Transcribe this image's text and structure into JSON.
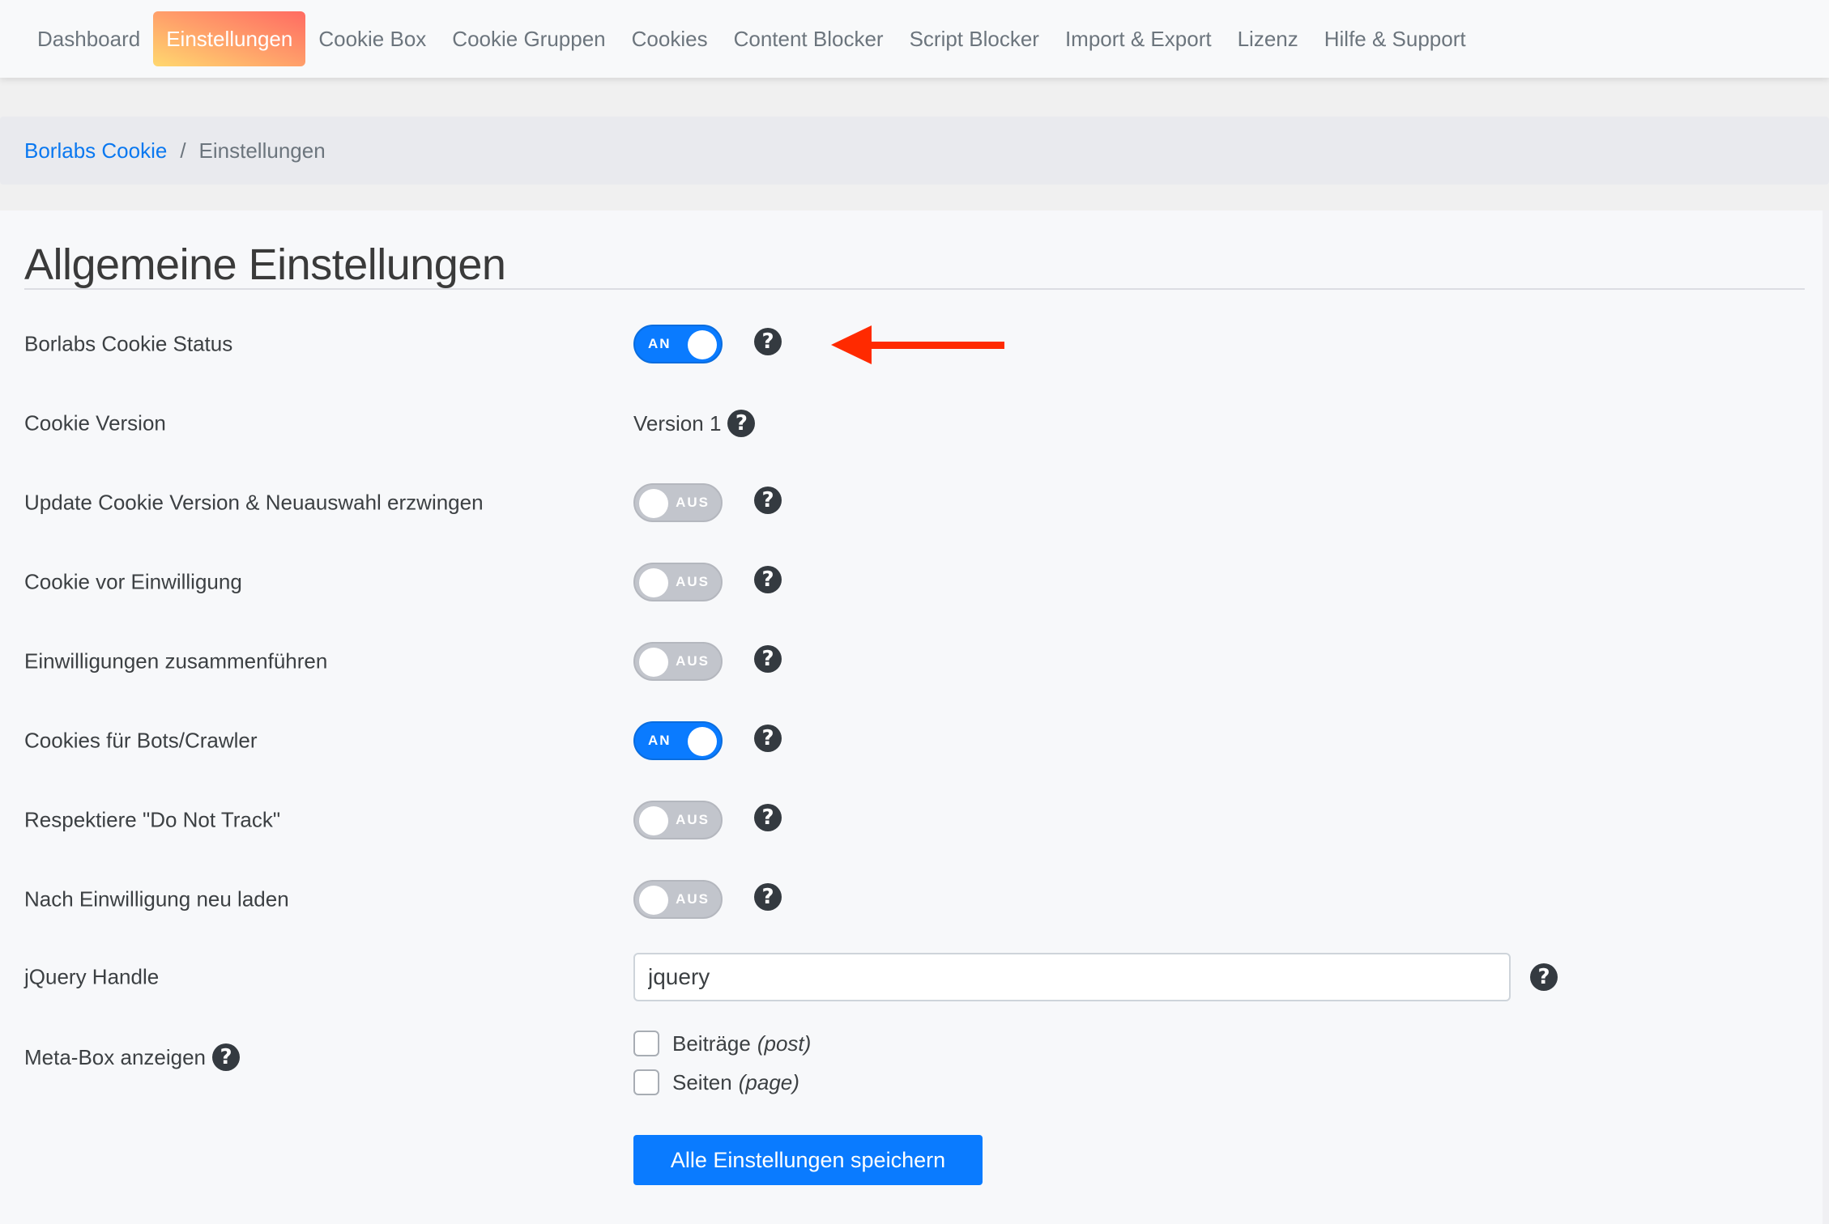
{
  "nav": {
    "items": [
      {
        "label": "Dashboard",
        "active": false
      },
      {
        "label": "Einstellungen",
        "active": true
      },
      {
        "label": "Cookie Box",
        "active": false
      },
      {
        "label": "Cookie Gruppen",
        "active": false
      },
      {
        "label": "Cookies",
        "active": false
      },
      {
        "label": "Content Blocker",
        "active": false
      },
      {
        "label": "Script Blocker",
        "active": false
      },
      {
        "label": "Import & Export",
        "active": false
      },
      {
        "label": "Lizenz",
        "active": false
      },
      {
        "label": "Hilfe & Support",
        "active": false
      }
    ]
  },
  "breadcrumb": {
    "root": "Borlabs Cookie",
    "separator": "/",
    "current": "Einstellungen"
  },
  "page": {
    "title": "Allgemeine Einstellungen"
  },
  "settings": {
    "status": {
      "label": "Borlabs Cookie Status",
      "value": true,
      "toggle_text": "AN"
    },
    "version": {
      "label": "Cookie Version",
      "value": "Version 1"
    },
    "update_version": {
      "label": "Update Cookie Version & Neuauswahl erzwingen",
      "value": false,
      "toggle_text": "AUS"
    },
    "cookie_before_consent": {
      "label": "Cookie vor Einwilligung",
      "value": false,
      "toggle_text": "AUS"
    },
    "aggregate_consents": {
      "label": "Einwilligungen zusammenführen",
      "value": false,
      "toggle_text": "AUS"
    },
    "cookies_for_bots": {
      "label": "Cookies für Bots/Crawler",
      "value": true,
      "toggle_text": "AN"
    },
    "respect_dnt": {
      "label": "Respektiere \"Do Not Track\"",
      "value": false,
      "toggle_text": "AUS"
    },
    "reload_after_consent": {
      "label": "Nach Einwilligung neu laden",
      "value": false,
      "toggle_text": "AUS"
    },
    "jquery_handle": {
      "label": "jQuery Handle",
      "value": "jquery"
    },
    "meta_box": {
      "label": "Meta-Box anzeigen",
      "options": [
        {
          "label": "Beiträge",
          "hint": "(post)",
          "checked": false
        },
        {
          "label": "Seiten",
          "hint": "(page)",
          "checked": false
        }
      ]
    }
  },
  "actions": {
    "save_label": "Alle Einstellungen speichern"
  },
  "icons": {
    "help": "?"
  },
  "colors": {
    "accent": "#0a7bff",
    "toggle_off": "#c2c5cc",
    "annotation_arrow": "#ff2a00",
    "active_tab_gradient": [
      "#ffd86f",
      "#ff6b62"
    ]
  }
}
